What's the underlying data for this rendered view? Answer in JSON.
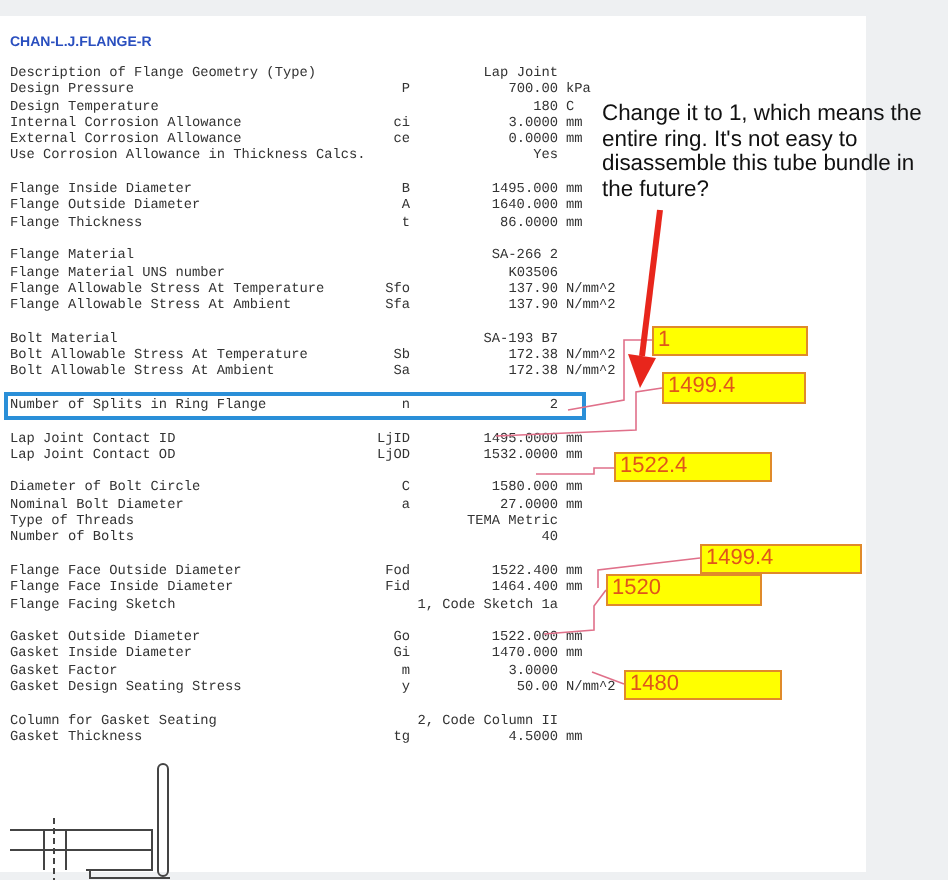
{
  "title": "CHAN-L.J.FLANGE-R",
  "sections": [
    {
      "highlighted": false,
      "rows": [
        {
          "label": "Description of Flange Geometry (Type)",
          "symbol": "",
          "value": "Lap Joint",
          "unit": ""
        },
        {
          "label": "Design Pressure",
          "symbol": "P",
          "value": "700.00",
          "unit": "kPa"
        },
        {
          "label": "Design Temperature",
          "symbol": "",
          "value": "180",
          "unit": "C"
        },
        {
          "label": "Internal Corrosion Allowance",
          "symbol": "ci",
          "value": "3.0000",
          "unit": "mm"
        },
        {
          "label": "External Corrosion Allowance",
          "symbol": "ce",
          "value": "0.0000",
          "unit": "mm"
        },
        {
          "label": "Use Corrosion Allowance in Thickness Calcs.",
          "symbol": "",
          "value": "Yes",
          "unit": ""
        }
      ]
    },
    {
      "highlighted": false,
      "rows": [
        {
          "label": "Flange Inside Diameter",
          "symbol": "B",
          "value": "1495.000",
          "unit": "mm"
        },
        {
          "label": "Flange Outside Diameter",
          "symbol": "A",
          "value": "1640.000",
          "unit": "mm"
        },
        {
          "label": "Flange Thickness",
          "symbol": "t",
          "value": "86.0000",
          "unit": "mm"
        }
      ]
    },
    {
      "highlighted": false,
      "rows": [
        {
          "label": "Flange Material",
          "symbol": "",
          "value": "SA-266 2",
          "unit": ""
        },
        {
          "label": "Flange Material UNS number",
          "symbol": "",
          "value": "K03506",
          "unit": ""
        },
        {
          "label": "Flange Allowable Stress At Temperature",
          "symbol": "Sfo",
          "value": "137.90",
          "unit": "N/mm^2"
        },
        {
          "label": "Flange Allowable Stress At Ambient",
          "symbol": "Sfa",
          "value": "137.90",
          "unit": "N/mm^2"
        }
      ]
    },
    {
      "highlighted": false,
      "rows": [
        {
          "label": "Bolt Material",
          "symbol": "",
          "value": "SA-193 B7",
          "unit": ""
        },
        {
          "label": "Bolt Allowable Stress At Temperature",
          "symbol": "Sb",
          "value": "172.38",
          "unit": "N/mm^2"
        },
        {
          "label": "Bolt Allowable Stress At Ambient",
          "symbol": "Sa",
          "value": "172.38",
          "unit": "N/mm^2"
        }
      ]
    },
    {
      "highlighted": true,
      "rows": [
        {
          "label": "Number of Splits in Ring Flange",
          "symbol": "n",
          "value": "2",
          "unit": ""
        }
      ]
    },
    {
      "highlighted": false,
      "rows": [
        {
          "label": "Lap Joint Contact ID",
          "symbol": "LjID",
          "value": "1495.0000",
          "unit": "mm"
        },
        {
          "label": "Lap Joint Contact OD",
          "symbol": "LjOD",
          "value": "1532.0000",
          "unit": "mm"
        }
      ]
    },
    {
      "highlighted": false,
      "rows": [
        {
          "label": "Diameter of Bolt Circle",
          "symbol": "C",
          "value": "1580.000",
          "unit": "mm"
        },
        {
          "label": "Nominal Bolt Diameter",
          "symbol": "a",
          "value": "27.0000",
          "unit": "mm"
        },
        {
          "label": "Type of Threads",
          "symbol": "",
          "value": "TEMA Metric",
          "unit": ""
        },
        {
          "label": "Number of Bolts",
          "symbol": "",
          "value": "40",
          "unit": ""
        }
      ]
    },
    {
      "highlighted": false,
      "rows": [
        {
          "label": "Flange Face Outside Diameter",
          "symbol": "Fod",
          "value": "1522.400",
          "unit": "mm"
        },
        {
          "label": "Flange Face Inside Diameter",
          "symbol": "Fid",
          "value": "1464.400",
          "unit": "mm"
        },
        {
          "label": "Flange Facing Sketch",
          "symbol": "",
          "value": "1, Code Sketch 1a",
          "unit": ""
        }
      ]
    },
    {
      "highlighted": false,
      "rows": [
        {
          "label": "Gasket Outside Diameter",
          "symbol": "Go",
          "value": "1522.000",
          "unit": "mm"
        },
        {
          "label": "Gasket Inside Diameter",
          "symbol": "Gi",
          "value": "1470.000",
          "unit": "mm"
        },
        {
          "label": "Gasket Factor",
          "symbol": "m",
          "value": "3.0000",
          "unit": ""
        },
        {
          "label": "Gasket Design Seating Stress",
          "symbol": "y",
          "value": "50.00",
          "unit": "N/mm^2"
        }
      ]
    },
    {
      "highlighted": false,
      "rows": [
        {
          "label": "Column for Gasket Seating",
          "symbol": "",
          "value": "2, Code Column II",
          "unit": ""
        },
        {
          "label": "Gasket Thickness",
          "symbol": "tg",
          "value": "4.5000",
          "unit": "mm"
        }
      ]
    }
  ],
  "comment": "Change it to 1, which means the entire ring. It's not easy to disassemble this tube bundle in the future?",
  "callouts": [
    {
      "text": "1"
    },
    {
      "text": "1499.4"
    },
    {
      "text": "1522.4"
    },
    {
      "text": "1499.4"
    },
    {
      "text": "1520"
    },
    {
      "text": "1480"
    }
  ]
}
